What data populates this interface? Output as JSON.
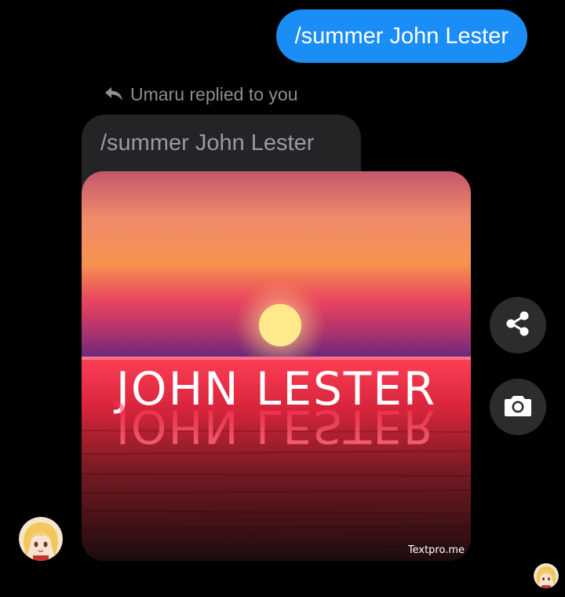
{
  "conversation": {
    "outgoing_message": {
      "text": "/summer John Lester",
      "bubble_color": "#1b8df6"
    },
    "reply": {
      "indicator_text": "Umaru replied to you",
      "indicator_icon": "reply-arrow-icon",
      "quoted_text": "/summer John Lester"
    },
    "image_message": {
      "headline": "JOHN LESTER",
      "watermark": "Textpro.me"
    },
    "actions": {
      "share_icon": "share-icon",
      "camera_icon": "camera-icon"
    },
    "avatars": {
      "sender": "anime-girl-avatar",
      "read_receipt": "anime-girl-avatar-small"
    }
  }
}
